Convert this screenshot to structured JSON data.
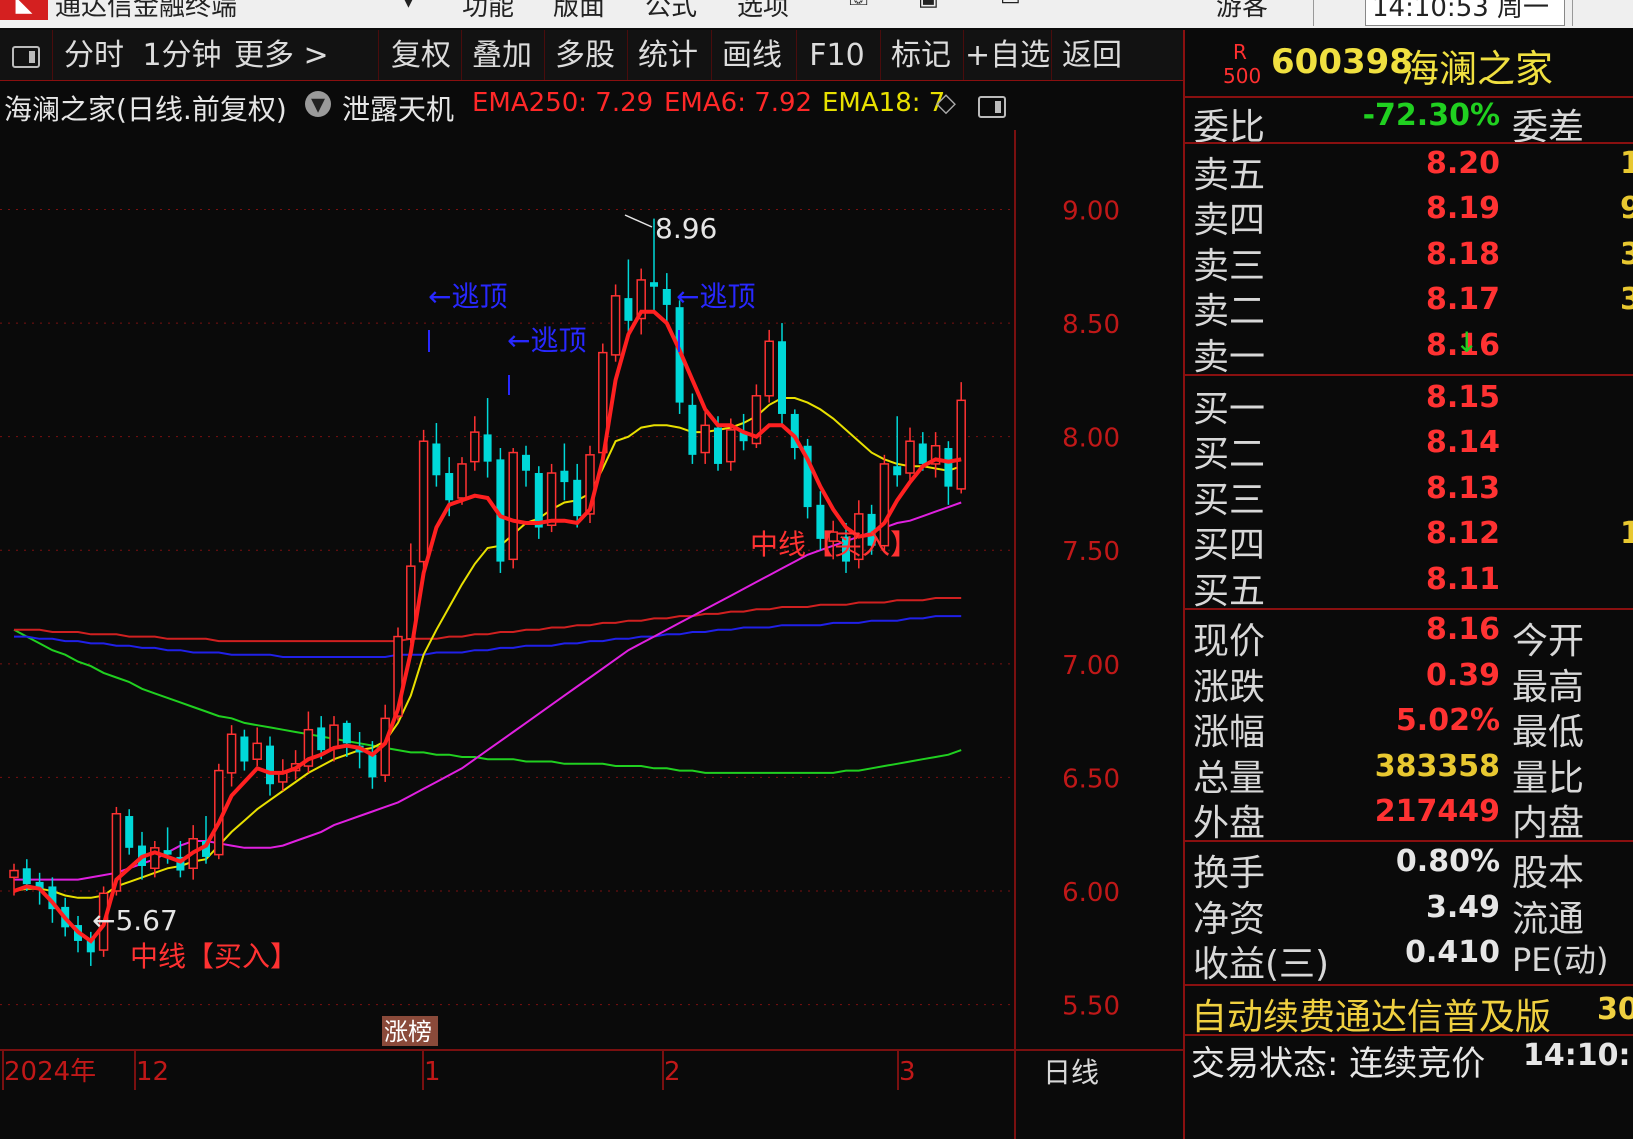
{
  "title_bar": {
    "app_name": "通达信金融终端",
    "menus": [
      "功能",
      "版面",
      "公式",
      "选项"
    ],
    "user": "游客",
    "clock": "14:10:53 周一"
  },
  "toolbar": {
    "items": [
      "分时",
      "1分钟",
      "更多 >",
      "复权",
      "叠加",
      "多股",
      "统计",
      "画线",
      "F10",
      "标记",
      "+自选",
      "返回"
    ]
  },
  "chart_header": {
    "title": "海澜之家(日线.前复权)",
    "indicator": "泄露天机",
    "ema250": "EMA250: 7.29",
    "ema6": "EMA6: 7.92",
    "ema18": "EMA18: 7"
  },
  "colors": {
    "up": "#ff3232",
    "down": "#00d8d8",
    "ema_red": "#ff2020",
    "ema_yellow": "#e8e000",
    "ema_magenta": "#e020e0",
    "ema_green": "#20d020",
    "ema_blue": "#2020e8",
    "ema_dark_red": "#d02020",
    "signal_blue": "#2828ff",
    "grid": "#7a1010"
  },
  "annotations": {
    "low_label": "←5.67",
    "high_label": "8.96",
    "escape_label": "←逃顶",
    "buy_label_1": "中线【买入】",
    "buy_label_2": "中线【买入】",
    "limit_badge": "涨榜"
  },
  "x_axis": {
    "labels": [
      "2024年",
      "12",
      "1",
      "2",
      "3"
    ],
    "period": "日线"
  },
  "chart_data": {
    "type": "candlestick",
    "y_ticks": [
      "9.00",
      "8.50",
      "8.00",
      "7.50",
      "7.00",
      "6.50",
      "6.00",
      "5.50"
    ],
    "ylim": [
      5.3,
      9.35
    ],
    "low": 5.67,
    "high": 8.96,
    "candles": [
      [
        6.06,
        6.12,
        5.98,
        6.09
      ],
      [
        6.1,
        6.14,
        6.0,
        6.03
      ],
      [
        6.04,
        6.08,
        5.94,
        6.01
      ],
      [
        6.02,
        6.06,
        5.86,
        5.92
      ],
      [
        5.93,
        5.97,
        5.8,
        5.84
      ],
      [
        5.85,
        5.89,
        5.73,
        5.78
      ],
      [
        5.79,
        5.82,
        5.67,
        5.73
      ],
      [
        5.74,
        6.02,
        5.71,
        5.99
      ],
      [
        6.0,
        6.37,
        5.98,
        6.34
      ],
      [
        6.33,
        6.36,
        6.16,
        6.19
      ],
      [
        6.2,
        6.26,
        6.05,
        6.11
      ],
      [
        6.1,
        6.22,
        6.06,
        6.19
      ],
      [
        6.18,
        6.28,
        6.12,
        6.16
      ],
      [
        6.15,
        6.22,
        6.06,
        6.09
      ],
      [
        6.1,
        6.29,
        6.05,
        6.23
      ],
      [
        6.22,
        6.33,
        6.12,
        6.15
      ],
      [
        6.16,
        6.56,
        6.14,
        6.53
      ],
      [
        6.52,
        6.73,
        6.46,
        6.69
      ],
      [
        6.68,
        6.71,
        6.53,
        6.57
      ],
      [
        6.58,
        6.72,
        6.55,
        6.65
      ],
      [
        6.64,
        6.68,
        6.42,
        6.47
      ],
      [
        6.48,
        6.58,
        6.44,
        6.52
      ],
      [
        6.53,
        6.62,
        6.49,
        6.56
      ],
      [
        6.55,
        6.79,
        6.52,
        6.71
      ],
      [
        6.72,
        6.77,
        6.58,
        6.62
      ],
      [
        6.63,
        6.77,
        6.57,
        6.73
      ],
      [
        6.74,
        6.75,
        6.59,
        6.65
      ],
      [
        6.64,
        6.7,
        6.54,
        6.61
      ],
      [
        6.6,
        6.66,
        6.45,
        6.5
      ],
      [
        6.51,
        6.82,
        6.48,
        6.76
      ],
      [
        6.77,
        7.16,
        6.75,
        7.12
      ],
      [
        7.11,
        7.53,
        7.09,
        7.43
      ],
      [
        7.45,
        8.03,
        7.4,
        7.98
      ],
      [
        7.97,
        8.06,
        7.78,
        7.83
      ],
      [
        7.84,
        7.91,
        7.65,
        7.72
      ],
      [
        7.73,
        7.91,
        7.7,
        7.88
      ],
      [
        7.89,
        8.09,
        7.85,
        8.02
      ],
      [
        8.01,
        8.17,
        7.82,
        7.89
      ],
      [
        7.9,
        7.95,
        7.4,
        7.45
      ],
      [
        7.46,
        7.95,
        7.42,
        7.93
      ],
      [
        7.92,
        7.96,
        7.78,
        7.85
      ],
      [
        7.84,
        7.87,
        7.55,
        7.6
      ],
      [
        7.61,
        7.88,
        7.58,
        7.84
      ],
      [
        7.85,
        7.97,
        7.72,
        7.8
      ],
      [
        7.81,
        7.88,
        7.6,
        7.65
      ],
      [
        7.66,
        7.96,
        7.62,
        7.92
      ],
      [
        7.93,
        8.41,
        7.9,
        8.37
      ],
      [
        8.36,
        8.67,
        8.33,
        8.62
      ],
      [
        8.61,
        8.78,
        8.45,
        8.51
      ],
      [
        8.52,
        8.74,
        8.45,
        8.69
      ],
      [
        8.68,
        8.96,
        8.55,
        8.66
      ],
      [
        8.65,
        8.72,
        8.5,
        8.58
      ],
      [
        8.57,
        8.6,
        8.1,
        8.15
      ],
      [
        8.14,
        8.19,
        7.88,
        7.92
      ],
      [
        7.93,
        8.12,
        7.88,
        8.05
      ],
      [
        8.04,
        8.09,
        7.85,
        7.88
      ],
      [
        7.89,
        8.08,
        7.85,
        8.03
      ],
      [
        8.02,
        8.1,
        7.94,
        7.98
      ],
      [
        7.97,
        8.23,
        7.95,
        8.18
      ],
      [
        8.18,
        8.47,
        8.15,
        8.42
      ],
      [
        8.42,
        8.5,
        8.05,
        8.1
      ],
      [
        8.1,
        8.12,
        7.9,
        7.95
      ],
      [
        7.96,
        7.99,
        7.64,
        7.69
      ],
      [
        7.7,
        7.76,
        7.5,
        7.55
      ],
      [
        7.54,
        7.63,
        7.46,
        7.58
      ],
      [
        7.56,
        7.62,
        7.4,
        7.45
      ],
      [
        7.46,
        7.72,
        7.42,
        7.66
      ],
      [
        7.66,
        7.7,
        7.48,
        7.52
      ],
      [
        7.52,
        7.92,
        7.49,
        7.88
      ],
      [
        7.87,
        8.09,
        7.78,
        7.83
      ],
      [
        7.84,
        8.04,
        7.8,
        7.98
      ],
      [
        7.97,
        8.02,
        7.85,
        7.88
      ],
      [
        7.88,
        8.02,
        7.82,
        7.96
      ],
      [
        7.95,
        7.98,
        7.7,
        7.78
      ],
      [
        7.77,
        8.24,
        7.75,
        8.16
      ]
    ],
    "ema_fast": [
      6.0,
      6.02,
      6.01,
      5.95,
      5.88,
      5.82,
      5.78,
      5.85,
      6.05,
      6.1,
      6.15,
      6.17,
      6.15,
      6.13,
      6.17,
      6.2,
      6.3,
      6.42,
      6.48,
      6.54,
      6.52,
      6.52,
      6.54,
      6.58,
      6.6,
      6.63,
      6.64,
      6.63,
      6.6,
      6.65,
      6.8,
      7.05,
      7.4,
      7.6,
      7.7,
      7.72,
      7.74,
      7.73,
      7.65,
      7.63,
      7.62,
      7.62,
      7.63,
      7.63,
      7.62,
      7.68,
      7.9,
      8.25,
      8.45,
      8.55,
      8.55,
      8.5,
      8.38,
      8.25,
      8.12,
      8.05,
      8.05,
      8.02,
      8.0,
      8.05,
      8.05,
      8.0,
      7.9,
      7.78,
      7.68,
      7.6,
      7.56,
      7.57,
      7.62,
      7.72,
      7.8,
      7.87,
      7.9,
      7.89,
      7.9
    ],
    "ema_mid": [
      6.0,
      6.01,
      6.01,
      6.0,
      5.98,
      5.97,
      5.97,
      5.98,
      6.02,
      6.04,
      6.06,
      6.08,
      6.1,
      6.11,
      6.13,
      6.14,
      6.2,
      6.26,
      6.31,
      6.36,
      6.4,
      6.44,
      6.48,
      6.52,
      6.55,
      6.58,
      6.6,
      6.62,
      6.63,
      6.66,
      6.74,
      6.86,
      7.04,
      7.15,
      7.25,
      7.35,
      7.44,
      7.51,
      7.52,
      7.57,
      7.62,
      7.64,
      7.68,
      7.71,
      7.72,
      7.75,
      7.86,
      7.98,
      8.0,
      8.04,
      8.05,
      8.05,
      8.04,
      8.02,
      8.02,
      8.03,
      8.04,
      8.06,
      8.09,
      8.14,
      8.17,
      8.17,
      8.15,
      8.12,
      8.08,
      8.03,
      7.98,
      7.93,
      7.9,
      7.88,
      7.87,
      7.87,
      7.86,
      7.85,
      7.87
    ],
    "ema_slow": [
      6.05,
      6.05,
      6.05,
      6.05,
      6.05,
      6.05,
      6.06,
      6.07,
      6.08,
      6.1,
      6.12,
      6.14,
      6.17,
      6.2,
      6.22,
      6.22,
      6.21,
      6.2,
      6.19,
      6.19,
      6.19,
      6.2,
      6.22,
      6.24,
      6.26,
      6.29,
      6.31,
      6.33,
      6.35,
      6.37,
      6.39,
      6.42,
      6.45,
      6.48,
      6.51,
      6.54,
      6.58,
      6.62,
      6.66,
      6.7,
      6.74,
      6.78,
      6.82,
      6.86,
      6.9,
      6.94,
      6.98,
      7.02,
      7.06,
      7.09,
      7.12,
      7.15,
      7.18,
      7.21,
      7.24,
      7.27,
      7.3,
      7.33,
      7.36,
      7.39,
      7.42,
      7.45,
      7.48,
      7.5,
      7.52,
      7.54,
      7.56,
      7.58,
      7.6,
      7.62,
      7.63,
      7.65,
      7.67,
      7.69,
      7.71
    ],
    "ema_green": [
      7.15,
      7.12,
      7.09,
      7.06,
      7.04,
      7.01,
      6.99,
      6.96,
      6.94,
      6.92,
      6.89,
      6.87,
      6.85,
      6.83,
      6.81,
      6.79,
      6.77,
      6.76,
      6.74,
      6.73,
      6.72,
      6.71,
      6.7,
      6.69,
      6.68,
      6.67,
      6.66,
      6.65,
      6.64,
      6.63,
      6.62,
      6.61,
      6.61,
      6.6,
      6.6,
      6.59,
      6.59,
      6.58,
      6.58,
      6.58,
      6.57,
      6.57,
      6.57,
      6.56,
      6.56,
      6.56,
      6.56,
      6.55,
      6.55,
      6.55,
      6.54,
      6.54,
      6.53,
      6.53,
      6.52,
      6.52,
      6.52,
      6.52,
      6.52,
      6.52,
      6.52,
      6.52,
      6.52,
      6.52,
      6.52,
      6.53,
      6.53,
      6.54,
      6.55,
      6.56,
      6.57,
      6.58,
      6.59,
      6.6,
      6.62
    ],
    "ema_blue": [
      7.12,
      7.12,
      7.11,
      7.11,
      7.1,
      7.1,
      7.09,
      7.09,
      7.08,
      7.08,
      7.07,
      7.07,
      7.06,
      7.06,
      7.05,
      7.05,
      7.05,
      7.04,
      7.04,
      7.04,
      7.04,
      7.03,
      7.03,
      7.03,
      7.03,
      7.03,
      7.03,
      7.03,
      7.03,
      7.03,
      7.04,
      7.04,
      7.04,
      7.05,
      7.05,
      7.05,
      7.06,
      7.06,
      7.07,
      7.07,
      7.08,
      7.08,
      7.08,
      7.09,
      7.09,
      7.1,
      7.1,
      7.11,
      7.11,
      7.12,
      7.12,
      7.13,
      7.13,
      7.14,
      7.14,
      7.15,
      7.15,
      7.16,
      7.16,
      7.16,
      7.17,
      7.17,
      7.17,
      7.17,
      7.18,
      7.18,
      7.18,
      7.19,
      7.19,
      7.19,
      7.2,
      7.2,
      7.21,
      7.21,
      7.21
    ],
    "ema_dark_red": [
      7.15,
      7.15,
      7.15,
      7.14,
      7.14,
      7.14,
      7.13,
      7.13,
      7.13,
      7.12,
      7.12,
      7.12,
      7.11,
      7.11,
      7.11,
      7.11,
      7.1,
      7.1,
      7.1,
      7.1,
      7.1,
      7.1,
      7.1,
      7.1,
      7.1,
      7.1,
      7.1,
      7.1,
      7.1,
      7.1,
      7.1,
      7.11,
      7.11,
      7.11,
      7.12,
      7.12,
      7.13,
      7.13,
      7.14,
      7.14,
      7.15,
      7.15,
      7.16,
      7.16,
      7.17,
      7.17,
      7.18,
      7.18,
      7.19,
      7.19,
      7.2,
      7.2,
      7.21,
      7.21,
      7.22,
      7.22,
      7.23,
      7.23,
      7.24,
      7.24,
      7.25,
      7.25,
      7.25,
      7.26,
      7.26,
      7.26,
      7.27,
      7.27,
      7.27,
      7.28,
      7.28,
      7.28,
      7.29,
      7.29,
      7.29
    ]
  },
  "quote_panel": {
    "stock_badge_top": "R",
    "stock_badge_bottom": "500",
    "code": "600398",
    "name": "海澜之家",
    "weibi_label": "委比",
    "weibi_value": "-72.30%",
    "weicha_label": "委差",
    "asks": [
      {
        "label": "卖五",
        "price": "8.20",
        "qty": "1"
      },
      {
        "label": "卖四",
        "price": "8.19",
        "qty": "9"
      },
      {
        "label": "卖三",
        "price": "8.18",
        "qty": "3"
      },
      {
        "label": "卖二",
        "price": "8.17",
        "qty": "3"
      },
      {
        "label": "卖一",
        "price": "8.16",
        "qty": ""
      }
    ],
    "bids": [
      {
        "label": "买一",
        "price": "8.15",
        "qty": ""
      },
      {
        "label": "买二",
        "price": "8.14",
        "qty": ""
      },
      {
        "label": "买三",
        "price": "8.13",
        "qty": ""
      },
      {
        "label": "买四",
        "price": "8.12",
        "qty": "1"
      },
      {
        "label": "买五",
        "price": "8.11",
        "qty": ""
      }
    ],
    "stats": [
      {
        "label": "现价",
        "value": "8.16",
        "extra": "今开"
      },
      {
        "label": "涨跌",
        "value": "0.39",
        "extra": "最高"
      },
      {
        "label": "涨幅",
        "value": "5.02%",
        "extra": "最低"
      },
      {
        "label": "总量",
        "value": "383358",
        "extra": "量比"
      },
      {
        "label": "外盘",
        "value": "217449",
        "extra": "内盘"
      }
    ],
    "fund": [
      {
        "label": "换手",
        "value": "0.80%",
        "extra": "股本"
      },
      {
        "label": "净资",
        "value": "3.49",
        "extra": "流通"
      },
      {
        "label": "收益(三)",
        "value": "0.410",
        "extra": "PE(动)"
      }
    ],
    "promo": "自动续费通达信普及版",
    "promo_tail": "30",
    "status_label": "交易状态: 连续竞价",
    "status_time": "14:10:"
  }
}
